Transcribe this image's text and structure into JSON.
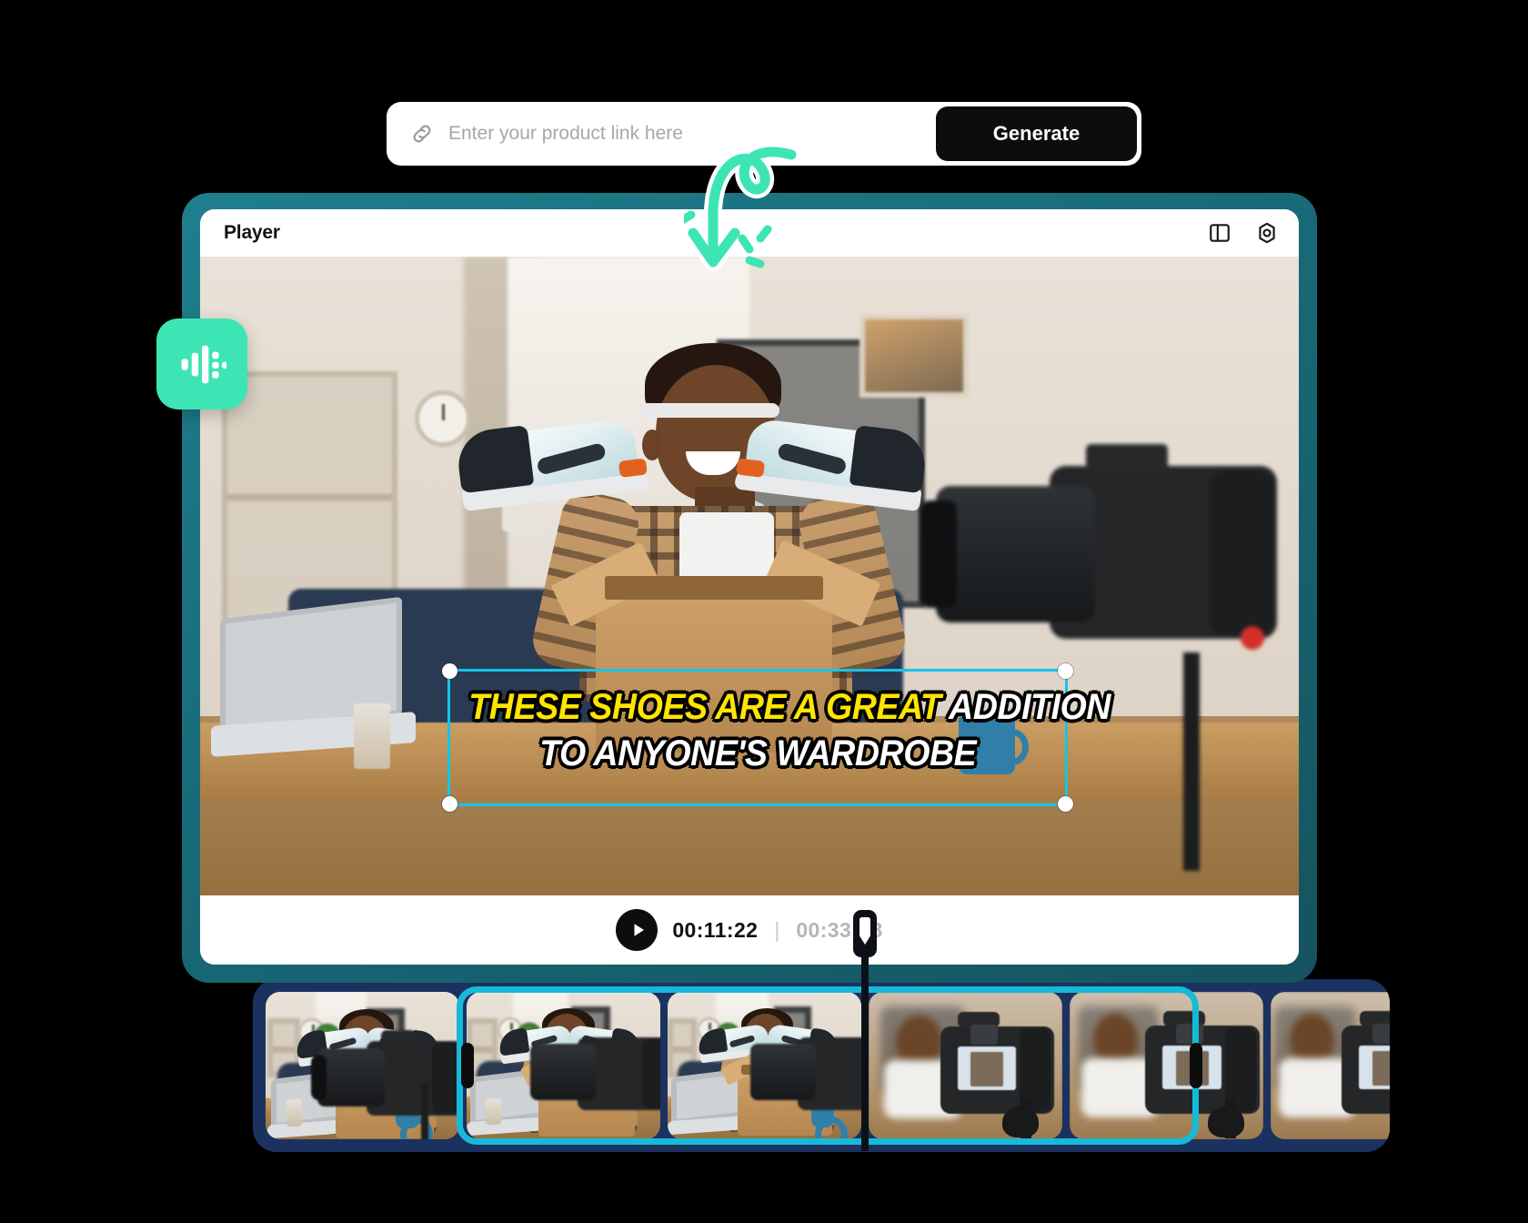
{
  "topbar": {
    "link_icon": "link-icon",
    "input_placeholder": "Enter your product link here",
    "input_value": "",
    "generate_label": "Generate"
  },
  "annotations": {
    "arrow_icon": "curved-down-arrow-icon",
    "cursor_icon": "mouse-pointer-icon",
    "accent_color": "#3ee5b4"
  },
  "audio_badge": {
    "icon": "audio-waveform-icon",
    "color": "#3ee5b4"
  },
  "player": {
    "title": "Player",
    "frame_color": "#1a6f7d",
    "header_icons": [
      {
        "name": "split-layout-icon",
        "label": "Layout"
      },
      {
        "name": "gear-icon",
        "label": "Settings"
      }
    ],
    "caption": {
      "highlight_text": "THESE SHOES ARE A GREAT ",
      "plain_text_1": "ADDITION",
      "line2": "TO ANYONE'S WARDROBE",
      "highlight_color": "#ffe500",
      "text_color": "#ffffff",
      "selection_color": "#17c4e8"
    },
    "controls": {
      "play_icon": "play-icon",
      "current_time": "00:11:22",
      "separator": "|",
      "total_time": "00:33:28"
    }
  },
  "timeline": {
    "panel_color": "#1b3260",
    "selection_color": "#17b9d8",
    "playhead_color": "#0d1117",
    "clips": [
      {
        "id": "clip-1",
        "selected": false
      },
      {
        "id": "clip-2",
        "selected": true
      },
      {
        "id": "clip-3",
        "selected": true
      },
      {
        "id": "clip-4",
        "selected": true
      },
      {
        "id": "clip-5",
        "selected": true
      },
      {
        "id": "clip-6",
        "selected": false
      }
    ]
  }
}
